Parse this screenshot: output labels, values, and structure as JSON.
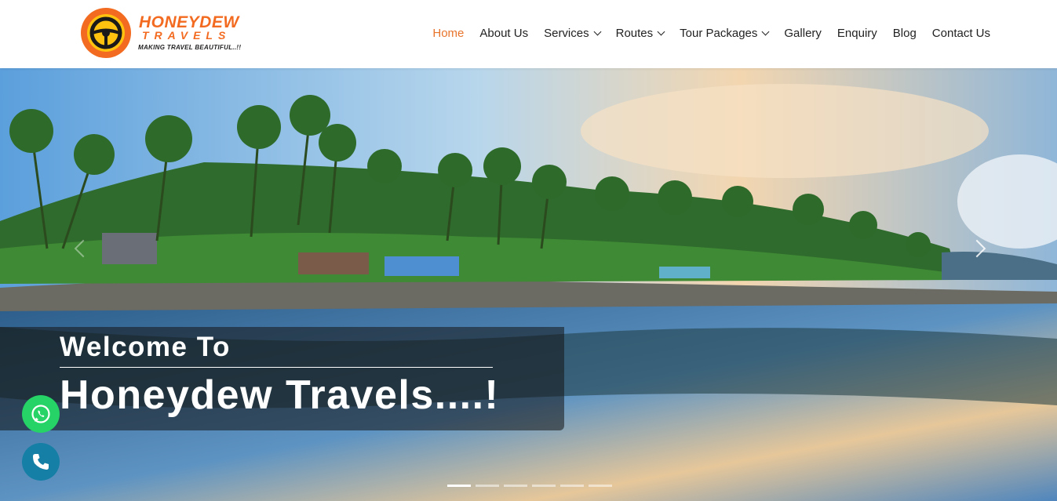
{
  "brand": {
    "name": "HONEYDEW",
    "sub": "TRAVELS",
    "tagline": "MAKING TRAVEL BEAUTIFUL..!!"
  },
  "nav": {
    "items": [
      {
        "label": "Home",
        "active": true,
        "dropdown": false
      },
      {
        "label": "About Us",
        "active": false,
        "dropdown": false
      },
      {
        "label": "Services",
        "active": false,
        "dropdown": true
      },
      {
        "label": "Routes",
        "active": false,
        "dropdown": true
      },
      {
        "label": "Tour Packages",
        "active": false,
        "dropdown": true
      },
      {
        "label": "Gallery",
        "active": false,
        "dropdown": false
      },
      {
        "label": "Enquiry",
        "active": false,
        "dropdown": false
      },
      {
        "label": "Blog",
        "active": false,
        "dropdown": false
      },
      {
        "label": "Contact Us",
        "active": false,
        "dropdown": false
      }
    ]
  },
  "hero": {
    "line1": "Welcome To",
    "line2": "Honeydew Travels....!",
    "slides": 6,
    "active_slide": 1
  },
  "floating": {
    "whatsapp": "whatsapp-icon",
    "call": "phone-icon"
  },
  "colors": {
    "accent": "#e8742c",
    "whatsapp": "#25d366",
    "call": "#157fa5"
  }
}
